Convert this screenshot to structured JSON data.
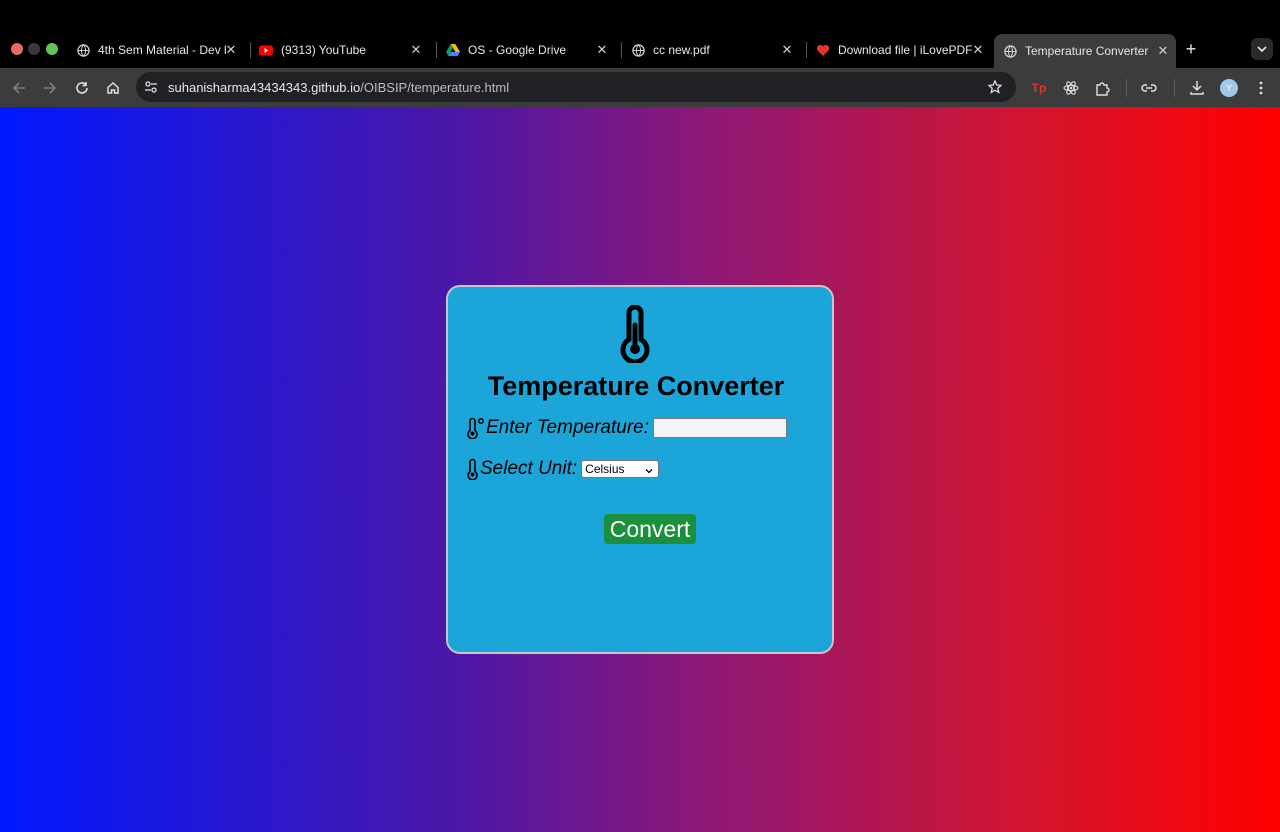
{
  "browser": {
    "tabs": [
      {
        "title": "4th Sem Material - Dev b",
        "icon": "globe-icon",
        "active": false
      },
      {
        "title": "(9313) YouTube",
        "icon": "youtube-icon",
        "active": false
      },
      {
        "title": "OS - Google Drive",
        "icon": "google-drive-icon",
        "active": false
      },
      {
        "title": "cc new.pdf",
        "icon": "globe-icon",
        "active": false
      },
      {
        "title": "Download file | iLovePDF",
        "icon": "ilovepdf-icon",
        "active": false
      },
      {
        "title": "Temperature Converter",
        "icon": "globe-icon",
        "active": true
      }
    ],
    "url_host": "suhanisharma43434343.github.io",
    "url_path": "/OIBSIP/temperature.html",
    "extension_label": "Tp",
    "profile_initial": "Y"
  },
  "app": {
    "title": "Temperature Converter",
    "temp_label": "Enter Temperature:",
    "temp_value": "",
    "unit_label": "Select Unit:",
    "unit_selected": "Celsius",
    "convert_label": "Convert"
  },
  "colors": {
    "card_bg": "#1ca5d8",
    "button_bg": "#1a8f3c",
    "gradient_start": "#0018ff",
    "gradient_end": "#ff0000"
  }
}
